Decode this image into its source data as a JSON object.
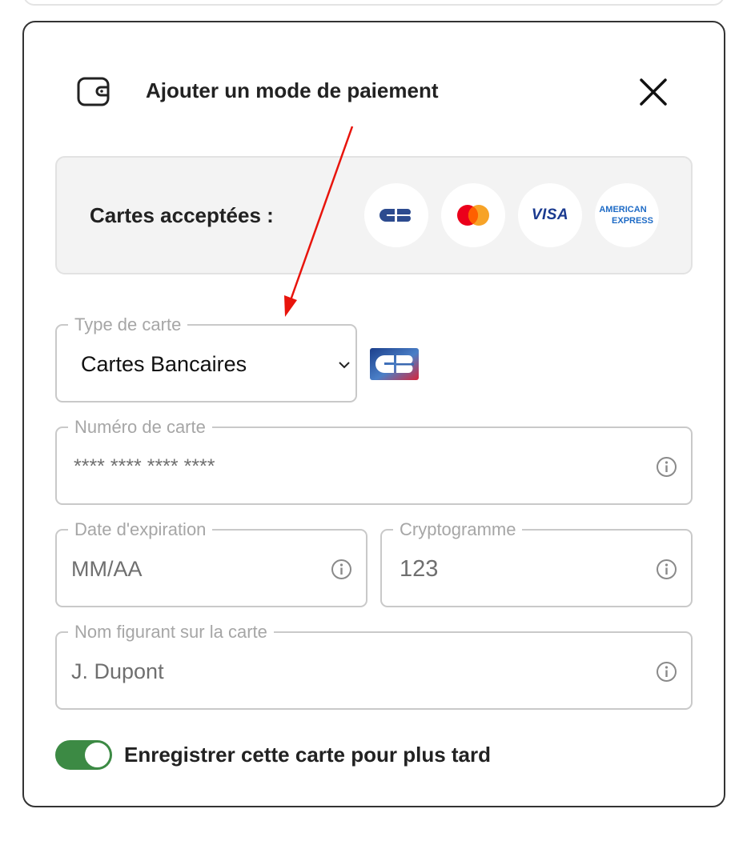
{
  "dialog": {
    "title": "Ajouter un mode de paiement",
    "wallet_icon": "wallet-icon",
    "close_icon": "close-icon"
  },
  "accepted_cards": {
    "label": "Cartes acceptées :",
    "brands": [
      {
        "name": "cb-logo"
      },
      {
        "name": "mastercard-logo"
      },
      {
        "name": "visa-logo",
        "text": "VISA"
      },
      {
        "name": "amex-logo",
        "line1": "AMERICAN",
        "line2": "EXPRESS"
      }
    ]
  },
  "card_type": {
    "label": "Type de carte",
    "value": "Cartes Bancaires",
    "icon": "chevron-down-icon"
  },
  "card_number": {
    "label": "Numéro de carte",
    "placeholder": "**** **** **** ****",
    "icon": "info-icon"
  },
  "expiry": {
    "label": "Date d'expiration",
    "placeholder": "MM/AA",
    "icon": "info-icon"
  },
  "cvv": {
    "label": "Cryptogramme",
    "placeholder": "123",
    "icon": "info-icon"
  },
  "cardholder": {
    "label": "Nom figurant sur la carte",
    "placeholder": "J. Dupont",
    "icon": "info-icon"
  },
  "save_card": {
    "label": "Enregistrer cette carte pour plus tard",
    "enabled": true
  },
  "colors": {
    "toggle_on": "#3c8a44",
    "annotation_arrow": "#e8140c",
    "visa_blue": "#1a3a8f",
    "amex_blue": "#1e6bc6",
    "mastercard_red": "#eb001b",
    "mastercard_orange": "#f79e1b",
    "cb_blue": "#2c4b8f"
  }
}
